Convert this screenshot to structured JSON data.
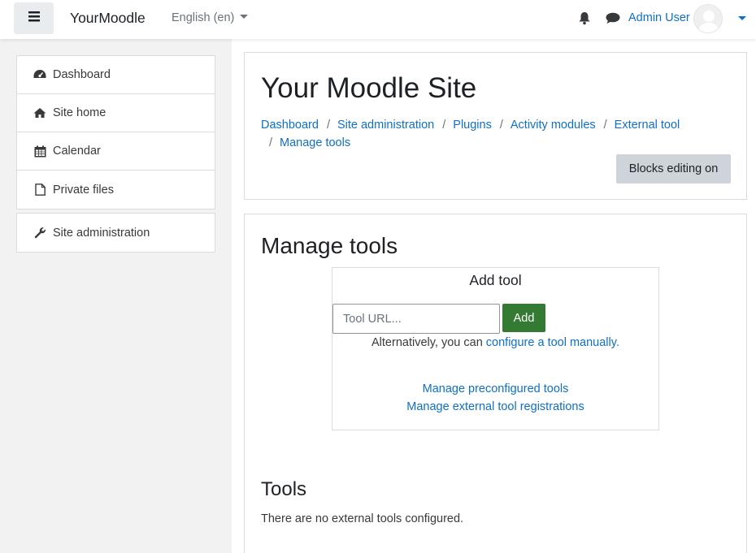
{
  "navbar": {
    "brand": "YourMoodle",
    "language": "English (en)",
    "user_name": "Admin User",
    "icons": [
      "bars-icon",
      "bell-icon",
      "comment-icon",
      "avatar",
      "chevron-down-icon"
    ]
  },
  "sidebar": {
    "items": [
      {
        "label": "Dashboard",
        "icon": "dashboard-icon"
      },
      {
        "label": "Site home",
        "icon": "home-icon"
      },
      {
        "label": "Calendar",
        "icon": "calendar-icon"
      },
      {
        "label": "Private files",
        "icon": "file-icon"
      }
    ],
    "admin": {
      "label": "Site administration",
      "icon": "wrench-icon"
    }
  },
  "header": {
    "site_title": "Your Moodle Site",
    "breadcrumb": [
      "Dashboard",
      "Site administration",
      "Plugins",
      "Activity modules",
      "External tool",
      "Manage tools"
    ],
    "blocks_editing": "Blocks editing on"
  },
  "main": {
    "title": "Manage tools",
    "add_tool": {
      "title": "Add tool",
      "placeholder": "Tool URL...",
      "add_label": "Add",
      "alt_prefix": "Alternatively, you can ",
      "alt_link": "configure a tool manually",
      "alt_suffix": ".",
      "preconfigured_link": "Manage preconfigured tools",
      "registrations_link": "Manage external tool registrations"
    },
    "tools": {
      "title": "Tools",
      "empty_message": "There are no external tools configured."
    }
  },
  "colors": {
    "link": "#0f6fc5",
    "add_button": "#357a32",
    "drawer_bg": "#f2f2f2",
    "secondary_button": "#ced4da"
  }
}
